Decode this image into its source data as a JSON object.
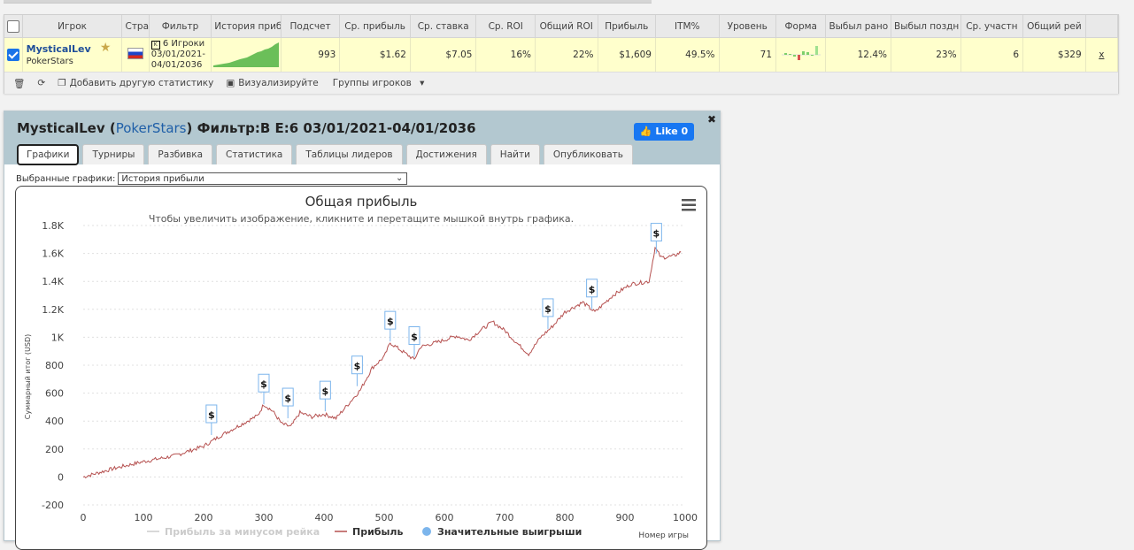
{
  "table": {
    "headers": [
      "Игрок",
      "Стра",
      "Фильтр",
      "История приб",
      "Подсчет",
      "Ср. прибыль",
      "Ср. ставка",
      "Ср. ROI",
      "Общий ROI",
      "Прибыль",
      "ITM%",
      "Уровень",
      "Форма",
      "Выбыл рано",
      "Выбыл поздн",
      "Ср. участн",
      "Общий рей"
    ],
    "row": {
      "player": "MysticalLev",
      "site": "PokerStars",
      "filter_line1": "6 Игроки",
      "filter_line2": "03/01/2021-",
      "filter_line3": "04/01/2036",
      "count": "993",
      "avg_profit": "$1.62",
      "avg_stake": "$7.05",
      "avg_roi": "16%",
      "total_roi": "22%",
      "profit": "$1,609",
      "itm": "49.5%",
      "level": "71",
      "early": "12.4%",
      "late": "23%",
      "avg_entrants": "6",
      "total_rake": "$329",
      "remove": "x"
    }
  },
  "toolbar": {
    "add_stat": "Добавить другую статистику",
    "visualize": "Визуализируйте",
    "groups": "Группы игроков"
  },
  "panel": {
    "player": "MysticalLev",
    "site": "PokerStars",
    "filter": "Фильтр:B E:6 03/01/2021-04/01/2036",
    "like": "Like 0",
    "tabs": [
      "Графики",
      "Турниры",
      "Разбивка",
      "Статистика",
      "Таблицы лидеров",
      "Достижения",
      "Найти",
      "Опубликовать"
    ],
    "selected_label": "Выбранные графики:",
    "selected_value": "История прибыли"
  },
  "colors": {
    "line": "#b5504f",
    "accent": "#1877f2",
    "header_bg": "#b3c8d0",
    "row_bg": "#ffffcc"
  },
  "chart_data": {
    "type": "line",
    "title": "Общая прибыль",
    "subtitle": "Чтобы увеличить изображение, кликните и перетащите мышкой внутрь графика.",
    "ylabel": "Суммарный итог (USD)",
    "xlabel": "Номер игры",
    "ylim": [
      -200,
      1800
    ],
    "xlim": [
      0,
      1000
    ],
    "yticks": [
      "-200",
      "0",
      "200",
      "400",
      "600",
      "800",
      "1K",
      "1.2K",
      "1.4K",
      "1.6K",
      "1.8K"
    ],
    "xticks": [
      "0",
      "100",
      "200",
      "300",
      "400",
      "500",
      "600",
      "700",
      "800",
      "900",
      "1000"
    ],
    "series": [
      {
        "name": "Прибыль",
        "x": [
          0,
          50,
          100,
          150,
          200,
          230,
          260,
          290,
          300,
          315,
          330,
          345,
          360,
          380,
          400,
          420,
          440,
          460,
          480,
          500,
          510,
          530,
          550,
          560,
          600,
          620,
          640,
          660,
          680,
          700,
          720,
          740,
          760,
          780,
          800,
          830,
          850,
          880,
          910,
          940,
          950,
          960,
          980,
          993
        ],
        "y": [
          0,
          60,
          110,
          150,
          220,
          300,
          370,
          440,
          520,
          470,
          380,
          360,
          460,
          430,
          450,
          420,
          520,
          620,
          780,
          860,
          960,
          900,
          840,
          930,
          980,
          1010,
          980,
          1050,
          1110,
          1050,
          960,
          880,
          1000,
          1080,
          1180,
          1250,
          1180,
          1300,
          1380,
          1400,
          1640,
          1570,
          1580,
          1609
        ]
      }
    ],
    "legend": [
      "Прибыль за минусом рейка",
      "Прибыль",
      "Значительные выигрыши"
    ],
    "big_wins_x": [
      213,
      300,
      340,
      402,
      455,
      510,
      550,
      772,
      845,
      952
    ],
    "big_wins_y": [
      300,
      520,
      420,
      470,
      650,
      970,
      860,
      1060,
      1200,
      1600
    ],
    "big_win_label": "$"
  }
}
